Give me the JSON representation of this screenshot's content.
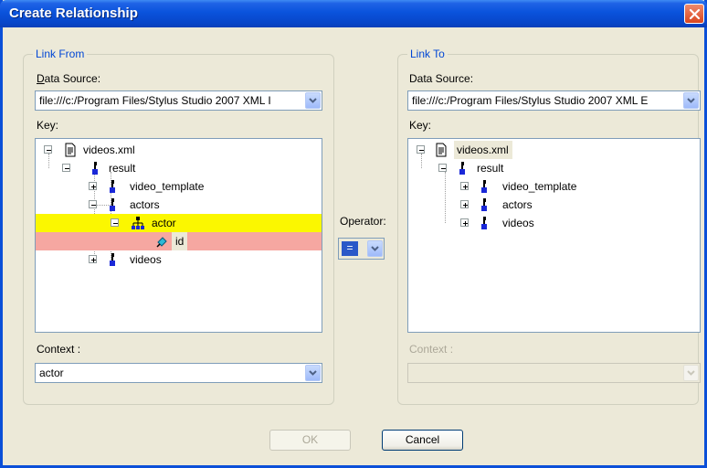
{
  "window": {
    "title": "Create Relationship"
  },
  "link_from": {
    "legend": "Link From",
    "data_source_label": "Data Source:",
    "data_source_value": "file:///c:/Program Files/Stylus Studio 2007 XML I",
    "key_label": "Key:",
    "tree": [
      {
        "label": "videos.xml",
        "icon": "document-icon"
      },
      {
        "label": "result",
        "icon": "element-icon"
      },
      {
        "label": "video_template",
        "icon": "element-icon"
      },
      {
        "label": "actors",
        "icon": "element-icon"
      },
      {
        "label": "actor",
        "icon": "repeating-element-icon"
      },
      {
        "label": "id",
        "icon": "attribute-icon"
      },
      {
        "label": "videos",
        "icon": "element-icon"
      }
    ],
    "context_label": "Context :",
    "context_value": "actor"
  },
  "operator": {
    "label": "Operator:",
    "value": "="
  },
  "link_to": {
    "legend": "Link To",
    "data_source_label": "Data Source:",
    "data_source_value": "file:///c:/Program Files/Stylus Studio 2007 XML E",
    "key_label": "Key:",
    "tree": [
      {
        "label": "videos.xml",
        "icon": "document-icon"
      },
      {
        "label": "result",
        "icon": "element-icon"
      },
      {
        "label": "video_template",
        "icon": "element-icon"
      },
      {
        "label": "actors",
        "icon": "element-icon"
      },
      {
        "label": "videos",
        "icon": "element-icon"
      }
    ],
    "context_label": "Context :",
    "context_value": ""
  },
  "buttons": {
    "ok": "OK",
    "cancel": "Cancel"
  },
  "colors": {
    "title_bar": "#0a53dc",
    "key_highlight": "#fbf700",
    "id_highlight": "#f6a7a1",
    "group_legend": "#0046d5"
  }
}
